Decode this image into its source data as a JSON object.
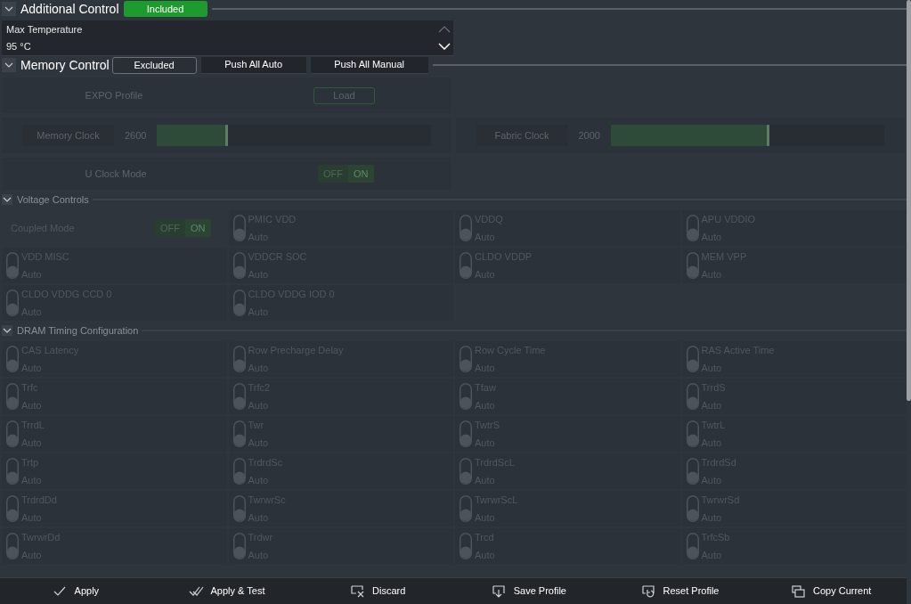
{
  "additional_control": {
    "title": "Additional Control",
    "expanded": true,
    "mode_button": {
      "label": "Included",
      "selected": true
    },
    "max_temperature": {
      "label": "Max Temperature",
      "value": "95 °C"
    }
  },
  "memory_control": {
    "title": "Memory Control",
    "expanded": true,
    "mode_button": {
      "label": "Excluded",
      "selected": false
    },
    "buttons": [
      "Push All Auto",
      "Push All Manual"
    ],
    "expo_profile": {
      "label": "EXPO Profile",
      "button": "Load"
    },
    "clocks": [
      {
        "label": "Memory Clock",
        "value": "2600",
        "level": 0.26
      },
      {
        "label": "Fabric Clock",
        "value": "2000",
        "level": 0.58
      }
    ],
    "u_clock_mode": {
      "label": "U Clock Mode",
      "off": "OFF",
      "on_label": "ON",
      "on": true
    }
  },
  "voltage_controls": {
    "title": "Voltage Controls",
    "expanded": true,
    "items": [
      {
        "kind": "toggle",
        "label": "Coupled Mode",
        "off": "OFF",
        "on_label": "ON",
        "on": true
      },
      {
        "kind": "switch",
        "label": "PMIC VDD",
        "value": "Auto",
        "manual": false
      },
      {
        "kind": "switch",
        "label": "VDDQ",
        "value": "Auto",
        "manual": false
      },
      {
        "kind": "switch",
        "label": "APU VDDIO",
        "value": "Auto",
        "manual": false
      },
      {
        "kind": "switch",
        "label": "VDD MISC",
        "value": "Auto",
        "manual": false
      },
      {
        "kind": "switch",
        "label": "VDDCR SOC",
        "value": "Auto",
        "manual": false
      },
      {
        "kind": "switch",
        "label": "CLDO VDDP",
        "value": "Auto",
        "manual": false
      },
      {
        "kind": "switch",
        "label": "MEM VPP",
        "value": "Auto",
        "manual": false
      },
      {
        "kind": "switch",
        "label": "CLDO VDDG CCD 0",
        "value": "Auto",
        "manual": false
      },
      {
        "kind": "switch",
        "label": "CLDO VDDG IOD 0",
        "value": "Auto",
        "manual": false
      }
    ]
  },
  "dram_timing": {
    "title": "DRAM Timing Configuration",
    "expanded": true,
    "items": [
      {
        "label": "CAS Latency",
        "value": "Auto",
        "manual": false
      },
      {
        "label": "Row Precharge Delay",
        "value": "Auto",
        "manual": false
      },
      {
        "label": "Row Cycle Time",
        "value": "Auto",
        "manual": false
      },
      {
        "label": "RAS Active Time",
        "value": "Auto",
        "manual": false
      },
      {
        "label": "Trfc",
        "value": "Auto",
        "manual": false
      },
      {
        "label": "Trfc2",
        "value": "Auto",
        "manual": false
      },
      {
        "label": "Tfaw",
        "value": "Auto",
        "manual": false
      },
      {
        "label": "TrrdS",
        "value": "Auto",
        "manual": false
      },
      {
        "label": "TrrdL",
        "value": "Auto",
        "manual": false
      },
      {
        "label": "Twr",
        "value": "Auto",
        "manual": false
      },
      {
        "label": "TwtrS",
        "value": "Auto",
        "manual": false
      },
      {
        "label": "TwtrL",
        "value": "Auto",
        "manual": false
      },
      {
        "label": "Trtp",
        "value": "Auto",
        "manual": false
      },
      {
        "label": "TrdrdSc",
        "value": "Auto",
        "manual": false
      },
      {
        "label": "TrdrdScL",
        "value": "Auto",
        "manual": false
      },
      {
        "label": "TrdrdSd",
        "value": "Auto",
        "manual": false
      },
      {
        "label": "TrdrdDd",
        "value": "Auto",
        "manual": false
      },
      {
        "label": "TwrwrSc",
        "value": "Auto",
        "manual": false
      },
      {
        "label": "TwrwrScL",
        "value": "Auto",
        "manual": false
      },
      {
        "label": "TwrwrSd",
        "value": "Auto",
        "manual": false
      },
      {
        "label": "TwrwrDd",
        "value": "Auto",
        "manual": false
      },
      {
        "label": "Trdwr",
        "value": "Auto",
        "manual": false
      },
      {
        "label": "Trcd",
        "value": "Auto",
        "manual": false
      },
      {
        "label": "TrfcSb",
        "value": "Auto",
        "manual": false
      }
    ]
  },
  "footer": [
    {
      "kind": "apply",
      "label": "Apply"
    },
    {
      "kind": "apply_test",
      "label": "Apply & Test"
    },
    {
      "kind": "discard",
      "label": "Discard"
    },
    {
      "kind": "save",
      "label": "Save Profile"
    },
    {
      "kind": "reset",
      "label": "Reset Profile"
    },
    {
      "kind": "copy",
      "label": "Copy Current"
    }
  ]
}
